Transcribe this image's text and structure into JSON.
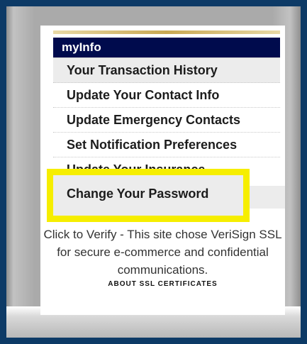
{
  "menu": {
    "header": "myInfo",
    "items": [
      "Your Transaction History",
      "Update Your Contact Info",
      "Update Emergency Contacts",
      "Set Notification Preferences",
      "Update Your Insurance"
    ],
    "highlighted_item": "Change Your Password"
  },
  "ssl": {
    "text": "Click to Verify - This site chose VeriSign SSL for secure e-commerce and confidential communications.",
    "link": "ABOUT SSL CERTIFICATES"
  },
  "colors": {
    "frame": "#0d3a66",
    "header_bg": "#000b4d",
    "highlight": "#f6ee00"
  }
}
